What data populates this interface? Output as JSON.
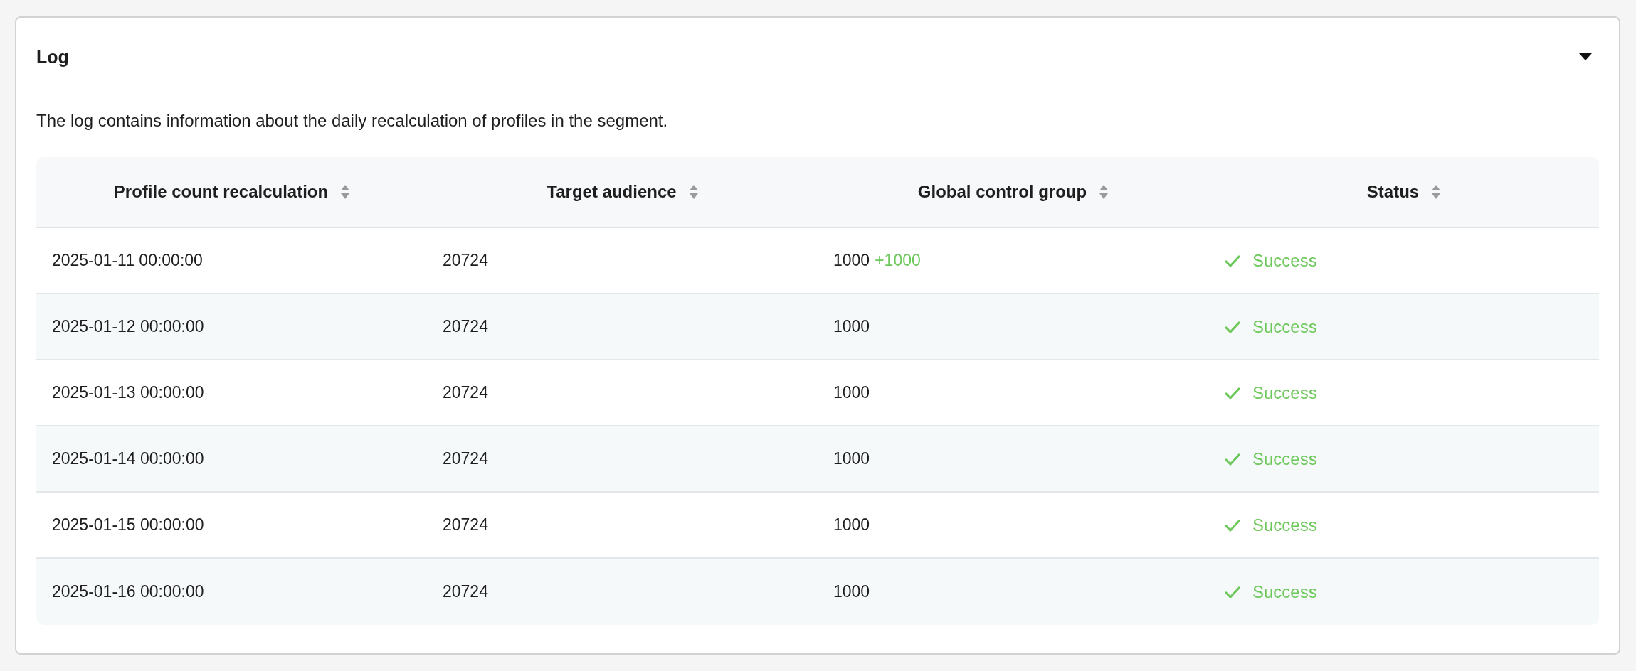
{
  "panel": {
    "title": "Log",
    "expanded": true,
    "description": "The log contains information about the daily recalculation of profiles in the segment."
  },
  "table": {
    "columns": [
      "Profile count recalculation",
      "Target audience",
      "Global control group",
      "Status"
    ],
    "rows": [
      {
        "date": "2025-01-11 00:00:00",
        "target_audience": "20724",
        "control_group": "1000",
        "control_group_delta": "+1000",
        "status": {
          "kind": "success",
          "label": "Success"
        }
      },
      {
        "date": "2025-01-12 00:00:00",
        "target_audience": "20724",
        "control_group": "1000",
        "status": {
          "kind": "success",
          "label": "Success"
        }
      },
      {
        "date": "2025-01-13 00:00:00",
        "target_audience": "20724",
        "control_group": "1000",
        "status": {
          "kind": "success",
          "label": "Success"
        }
      },
      {
        "date": "2025-01-14 00:00:00",
        "target_audience": "20724",
        "control_group": "1000",
        "status": {
          "kind": "success",
          "label": "Success"
        }
      },
      {
        "date": "2025-01-15 00:00:00",
        "target_audience": "20724",
        "control_group": "1000",
        "status": {
          "kind": "success",
          "label": "Success"
        }
      },
      {
        "date": "2025-01-16 00:00:00",
        "target_audience": "20724",
        "control_group": "1000",
        "status": {
          "kind": "success",
          "label": "Success"
        }
      }
    ]
  }
}
